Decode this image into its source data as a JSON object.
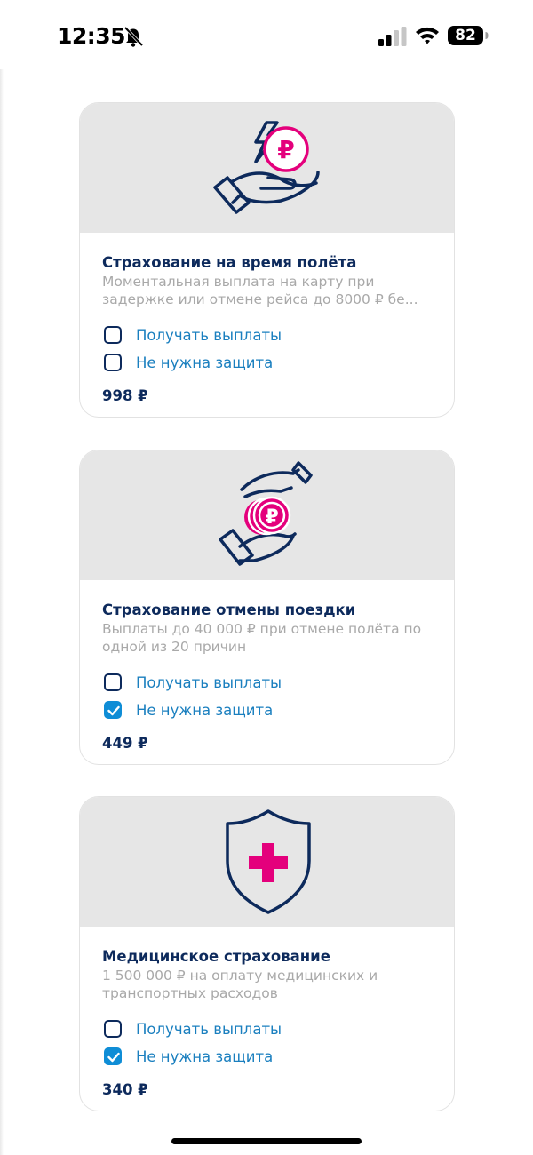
{
  "status_bar": {
    "time": "12:35",
    "battery": "82",
    "icons": [
      "bell-slash-icon",
      "signal-icon",
      "wifi-icon",
      "battery-icon"
    ]
  },
  "colors": {
    "navy": "#0d2a5c",
    "magenta": "#e4007c",
    "link_blue": "#1a7fbf",
    "checkbox_checked": "#0f8dd6",
    "image_bg": "#e6e6e6",
    "desc_gray": "#a9a9a9"
  },
  "cards": [
    {
      "icon": "hand-lightning-ruble-icon",
      "title": "Страхование на время полёта",
      "description": "Моментальная выплата на карту при задержке или отмене рейса до 8000 ₽ бе...",
      "options": [
        {
          "label": "Получать выплаты",
          "checked": false
        },
        {
          "label": "Не нужна защита",
          "checked": false
        }
      ],
      "price": "998 ₽"
    },
    {
      "icon": "hands-coins-icon",
      "title": "Страхование отмены поездки",
      "description": "Выплаты до 40 000 ₽ при отмене полёта по одной из 20 причин",
      "options": [
        {
          "label": "Получать выплаты",
          "checked": false
        },
        {
          "label": "Не нужна защита",
          "checked": true
        }
      ],
      "price": "449 ₽"
    },
    {
      "icon": "shield-medical-cross-icon",
      "title": "Медицинское страхование",
      "description": "1 500 000 ₽ на оплату медицинских и транспортных расходов",
      "options": [
        {
          "label": "Получать выплаты",
          "checked": false
        },
        {
          "label": "Не нужна защита",
          "checked": true
        }
      ],
      "price": "340 ₽"
    }
  ]
}
